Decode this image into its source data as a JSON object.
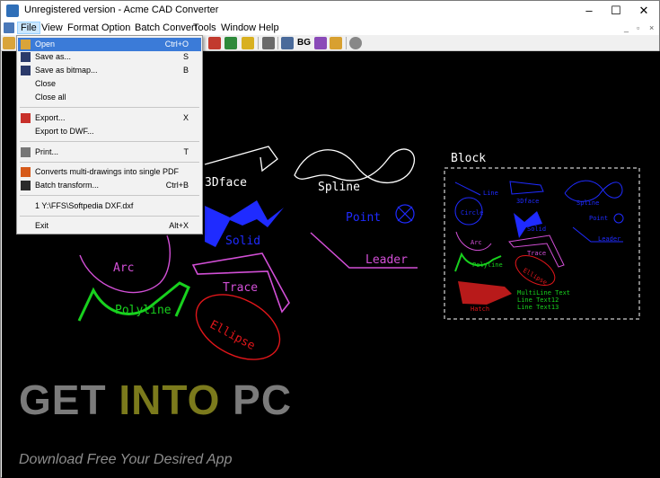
{
  "window": {
    "title": "Unregistered version - Acme CAD Converter",
    "controls": [
      "–",
      "☐",
      "✕"
    ]
  },
  "menubar": {
    "items": [
      "File",
      "View",
      "Format",
      "Option",
      "Batch Convert",
      "Tools",
      "Window",
      "Help"
    ],
    "mdi_controls": [
      "_",
      "▫",
      "×"
    ]
  },
  "toolbar": {
    "bg_label": "BG"
  },
  "file_menu": {
    "items": [
      {
        "label": "Open",
        "shortcut": "Ctrl+O"
      },
      {
        "label": "Save as...",
        "shortcut": "S"
      },
      {
        "label": "Save as bitmap...",
        "shortcut": "B"
      },
      {
        "label": "Close",
        "shortcut": ""
      },
      {
        "label": "Close all",
        "shortcut": ""
      },
      {
        "label": "Export...",
        "shortcut": "X"
      },
      {
        "label": "Export to DWF...",
        "shortcut": ""
      },
      {
        "label": "Print...",
        "shortcut": "T"
      },
      {
        "label": "Converts multi-drawings into single PDF",
        "shortcut": ""
      },
      {
        "label": "Batch transform...",
        "shortcut": "Ctrl+B"
      },
      {
        "label": "1 Y:\\FFS\\Softpedia DXF.dxf",
        "shortcut": ""
      },
      {
        "label": "Exit",
        "shortcut": "Alt+X"
      }
    ]
  },
  "drawing": {
    "labels": {
      "face3d": "3Dface",
      "spline": "Spline",
      "point": "Point",
      "solid": "Solid",
      "leader": "Leader",
      "arc": "Arc",
      "trace": "Trace",
      "polyline": "Polyline",
      "ellipse": "Ellipse",
      "block": "Block"
    },
    "block_labels": {
      "line": "Line",
      "circle": "Circle",
      "three_d_face": "3Dface",
      "spline": "Spline",
      "point": "Point",
      "solid": "Solid",
      "leader": "Leader",
      "arc": "Arc",
      "trace": "Trace",
      "polyline": "Polyline",
      "ellipse": "Ellipse",
      "hatch": "Hatch",
      "mline1": "MultiLine Text",
      "mline2": "Line Text12",
      "mline3": "Line Text13"
    }
  },
  "watermark": {
    "get": "GET ",
    "into": "INTO",
    "pc": " PC",
    "tagline": "Download Free Your Desired App"
  },
  "colors": {
    "cad_white": "#ffffff",
    "cad_blue": "#1f2bff",
    "cad_magenta": "#d24fd6",
    "cad_green": "#18d11e",
    "cad_red": "#e0161a",
    "menu_highlight": "#3b7bd8",
    "watermark_gray": "#7b7b7b",
    "watermark_yellow": "#7b7a1c"
  }
}
